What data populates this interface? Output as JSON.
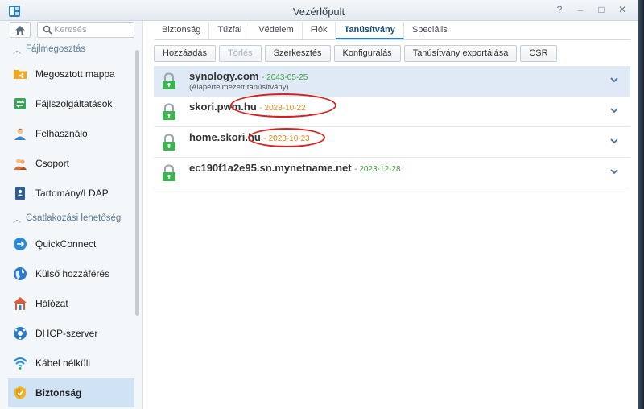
{
  "window": {
    "title": "Vezérlőpult",
    "buttons": [
      "?",
      "–",
      "□",
      "✕"
    ]
  },
  "sidebar": {
    "search_placeholder": "Keresés",
    "sections": [
      {
        "label": "Fájlmegosztás"
      },
      {
        "label": "Csatlakozási lehetőség"
      }
    ],
    "items": [
      {
        "label": "Megosztott mappa",
        "icon": "shared-folder-icon"
      },
      {
        "label": "Fájlszolgáltatások",
        "icon": "file-services-icon"
      },
      {
        "label": "Felhasználó",
        "icon": "user-icon"
      },
      {
        "label": "Csoport",
        "icon": "group-icon"
      },
      {
        "label": "Tartomány/LDAP",
        "icon": "domain-icon"
      },
      {
        "label": "QuickConnect",
        "icon": "quickconnect-icon"
      },
      {
        "label": "Külső hozzáférés",
        "icon": "globe-icon"
      },
      {
        "label": "Hálózat",
        "icon": "house-icon"
      },
      {
        "label": "DHCP-szerver",
        "icon": "dhcp-icon"
      },
      {
        "label": "Kábel nélküli",
        "icon": "wifi-icon"
      },
      {
        "label": "Biztonság",
        "icon": "shield-icon",
        "active": true
      }
    ]
  },
  "tabs": [
    "Biztonság",
    "Tűzfal",
    "Védelem",
    "Fiók",
    "Tanúsítvány",
    "Speciális"
  ],
  "active_tab": "Tanúsítvány",
  "toolbar": {
    "add": "Hozzáadás",
    "delete": "Törlés",
    "edit": "Szerkesztés",
    "configure": "Konfigurálás",
    "export": "Tanúsítvány exportálása",
    "csr": "CSR"
  },
  "certificates": [
    {
      "name": "synology.com",
      "date": "2043-05-25",
      "date_color": "green",
      "note": "(Alapértelmezett tanúsítvány)",
      "selected": true
    },
    {
      "name": "skori.pwm.hu",
      "date": "2023-10-22",
      "date_color": "orange"
    },
    {
      "name": "home.skori.hu",
      "date": "2023-10-23",
      "date_color": "orange"
    },
    {
      "name": "ec190f1a2e95.sn.mynetname.net",
      "date": "2023-12-28",
      "date_color": "green"
    }
  ],
  "colors": {
    "accent": "#2f7dc1",
    "green": "#3ea33e",
    "orange": "#e08a1e",
    "annotation": "#d62020"
  }
}
